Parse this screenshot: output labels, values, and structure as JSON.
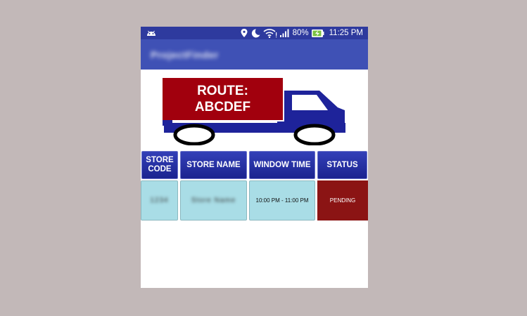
{
  "colors": {
    "background": "#c2b8b8",
    "status_bar": "#2e3a9e",
    "app_bar": "#3f51b5",
    "route_box": "#a1000d",
    "truck_blue": "#1e239a",
    "header_blue": "#1b238f",
    "cell_cyan": "#a9dde6",
    "pending_red": "#8b1414"
  },
  "status_bar": {
    "battery_percent": "80%",
    "time": "11:25 PM",
    "icons": [
      "android-icon",
      "location-icon",
      "moon-icon",
      "wifi-icon",
      "signal-icon",
      "battery-charging-icon"
    ]
  },
  "app_bar": {
    "title": "ProjectFinder"
  },
  "banner": {
    "route_line1": "ROUTE:",
    "route_line2": "ABCDEF",
    "icon": "truck-icon"
  },
  "table": {
    "headers": {
      "store_code": "STORE CODE",
      "store_name": "STORE NAME",
      "window_time": "WINDOW TIME",
      "status": "STATUS"
    },
    "rows": [
      {
        "store_code": "1234",
        "store_name": "Store Name",
        "window_time": "10:00 PM - 11:00 PM",
        "status": "PENDING"
      }
    ]
  }
}
